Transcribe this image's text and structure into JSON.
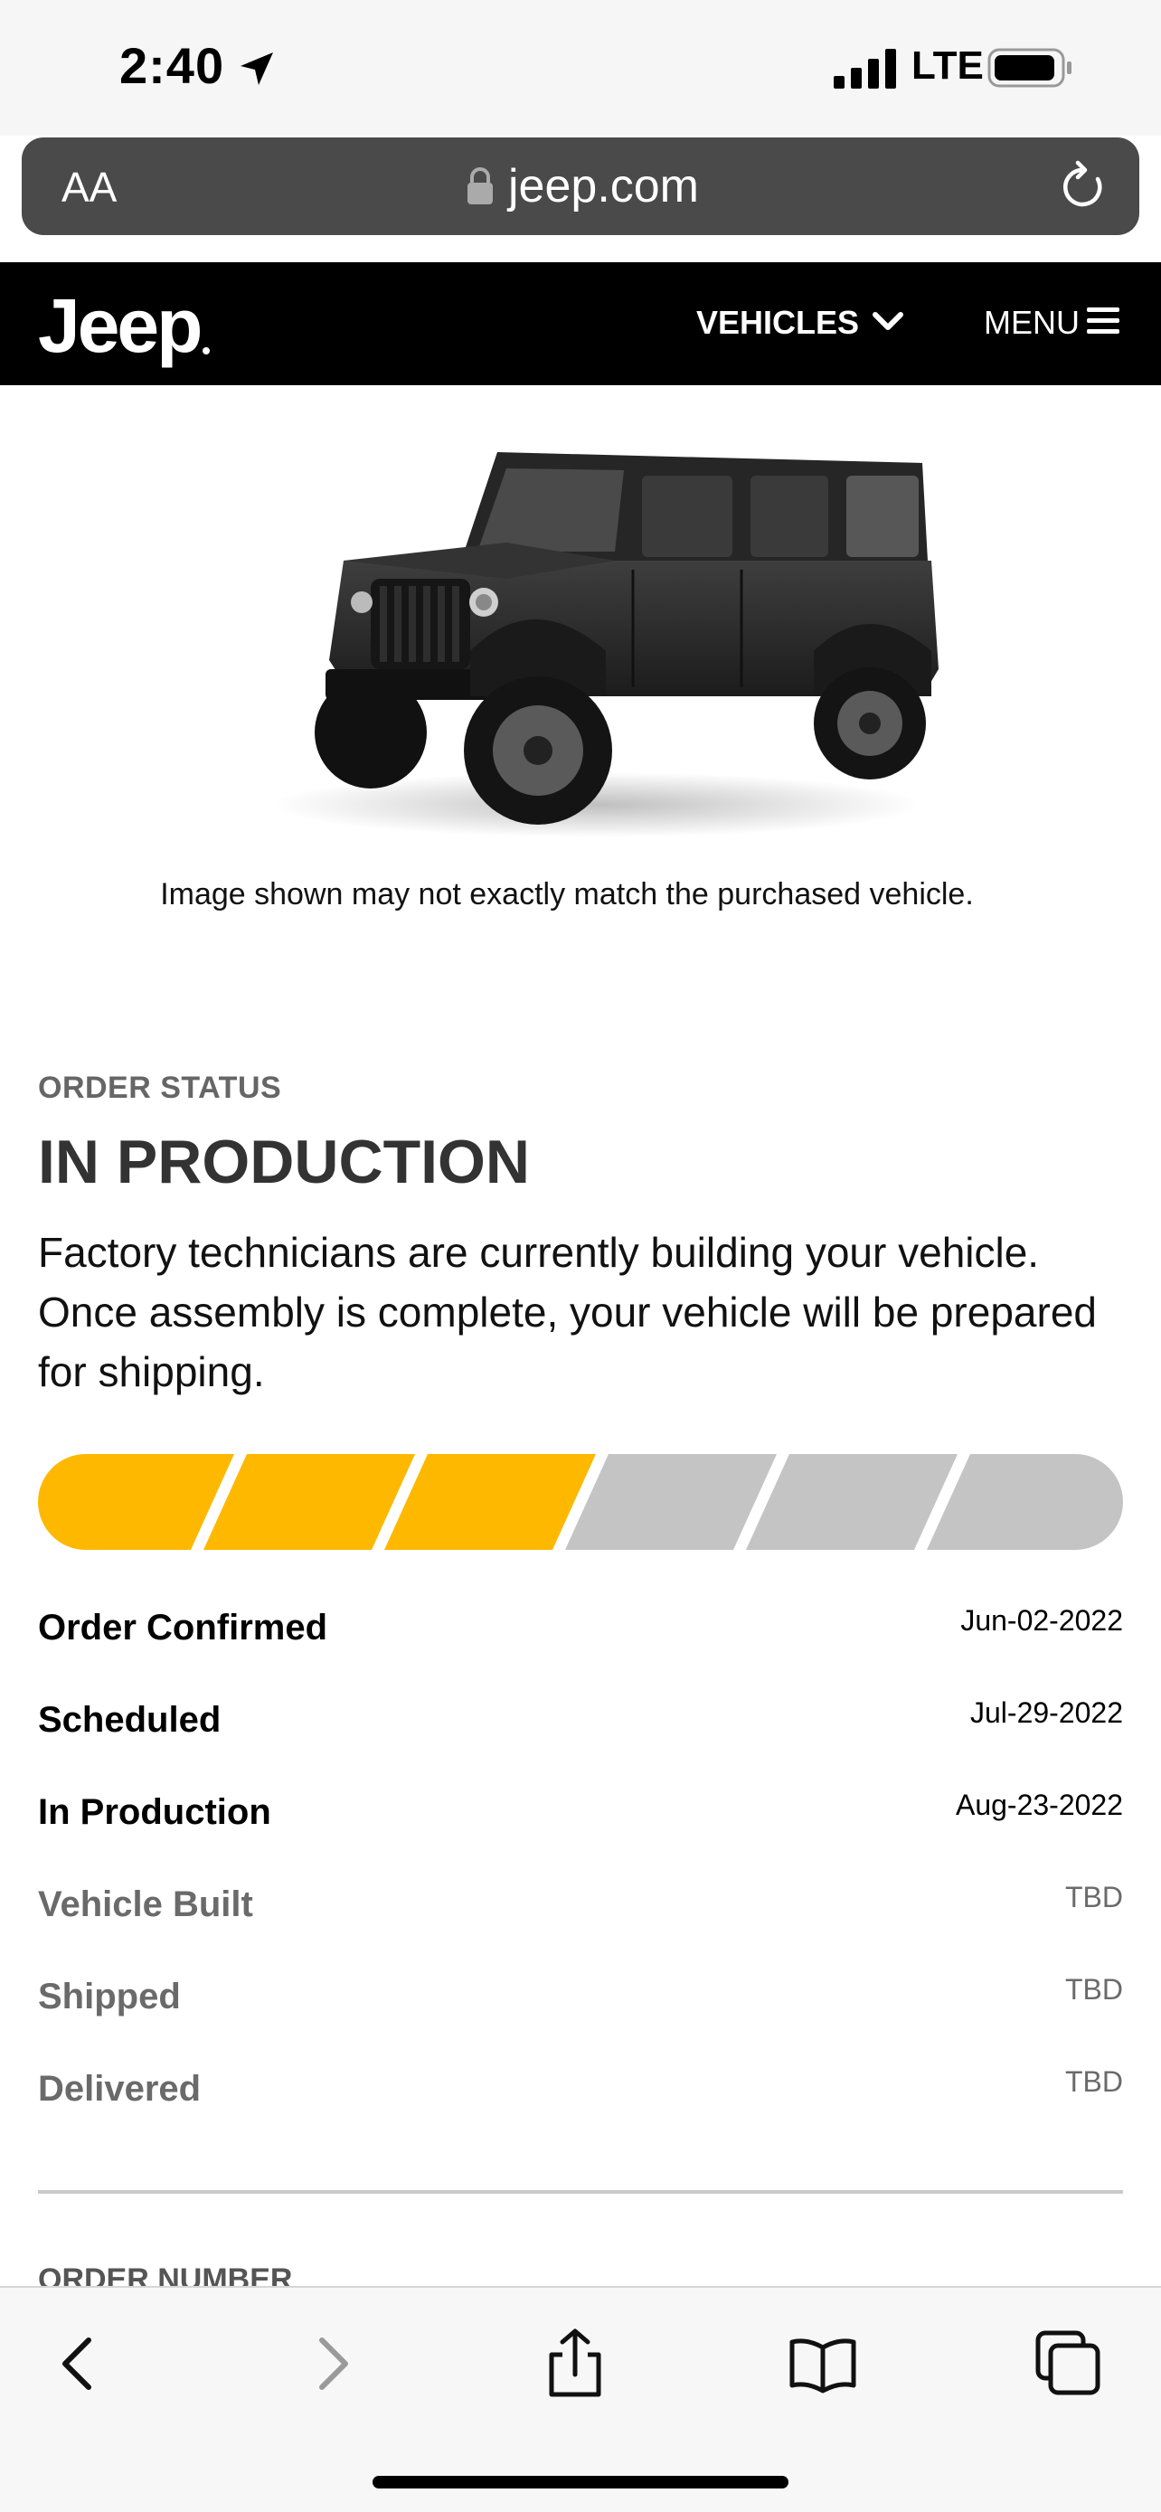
{
  "status_bar": {
    "time": "2:40",
    "network": "LTE",
    "icons": [
      "location-arrow-icon",
      "signal-icon",
      "battery-icon"
    ]
  },
  "browser": {
    "text_size_label": "AA",
    "url": "jeep.com",
    "icons": [
      "lock-icon",
      "reload-icon"
    ]
  },
  "nav": {
    "brand": "Jeep",
    "vehicles_label": "VEHICLES",
    "menu_label": "MENU"
  },
  "vehicle": {
    "disclaimer": "Image shown may not exactly match the purchased vehicle."
  },
  "order_status": {
    "label": "ORDER STATUS",
    "title": "IN PRODUCTION",
    "description": "Factory technicians are currently building your vehicle. Once assembly is complete, your vehicle will be prepared for shipping.",
    "progress": {
      "completed_segments": 3,
      "total_segments": 6
    },
    "colors": {
      "complete": "#FFB800",
      "pending": "#C4C4C4"
    },
    "milestones": [
      {
        "name": "Order Confirmed",
        "date": "Jun-02-2022",
        "state": "done"
      },
      {
        "name": "Scheduled",
        "date": "Jul-29-2022",
        "state": "done"
      },
      {
        "name": "In Production",
        "date": "Aug-23-2022",
        "state": "done"
      },
      {
        "name": "Vehicle Built",
        "date": "TBD",
        "state": "pending"
      },
      {
        "name": "Shipped",
        "date": "TBD",
        "state": "pending"
      },
      {
        "name": "Delivered",
        "date": "TBD",
        "state": "pending"
      }
    ]
  },
  "order_number": {
    "label": "ORDER NUMBER"
  },
  "toolbar": {
    "icons": [
      "back-icon",
      "forward-icon",
      "share-icon",
      "bookmarks-icon",
      "tabs-icon"
    ]
  }
}
